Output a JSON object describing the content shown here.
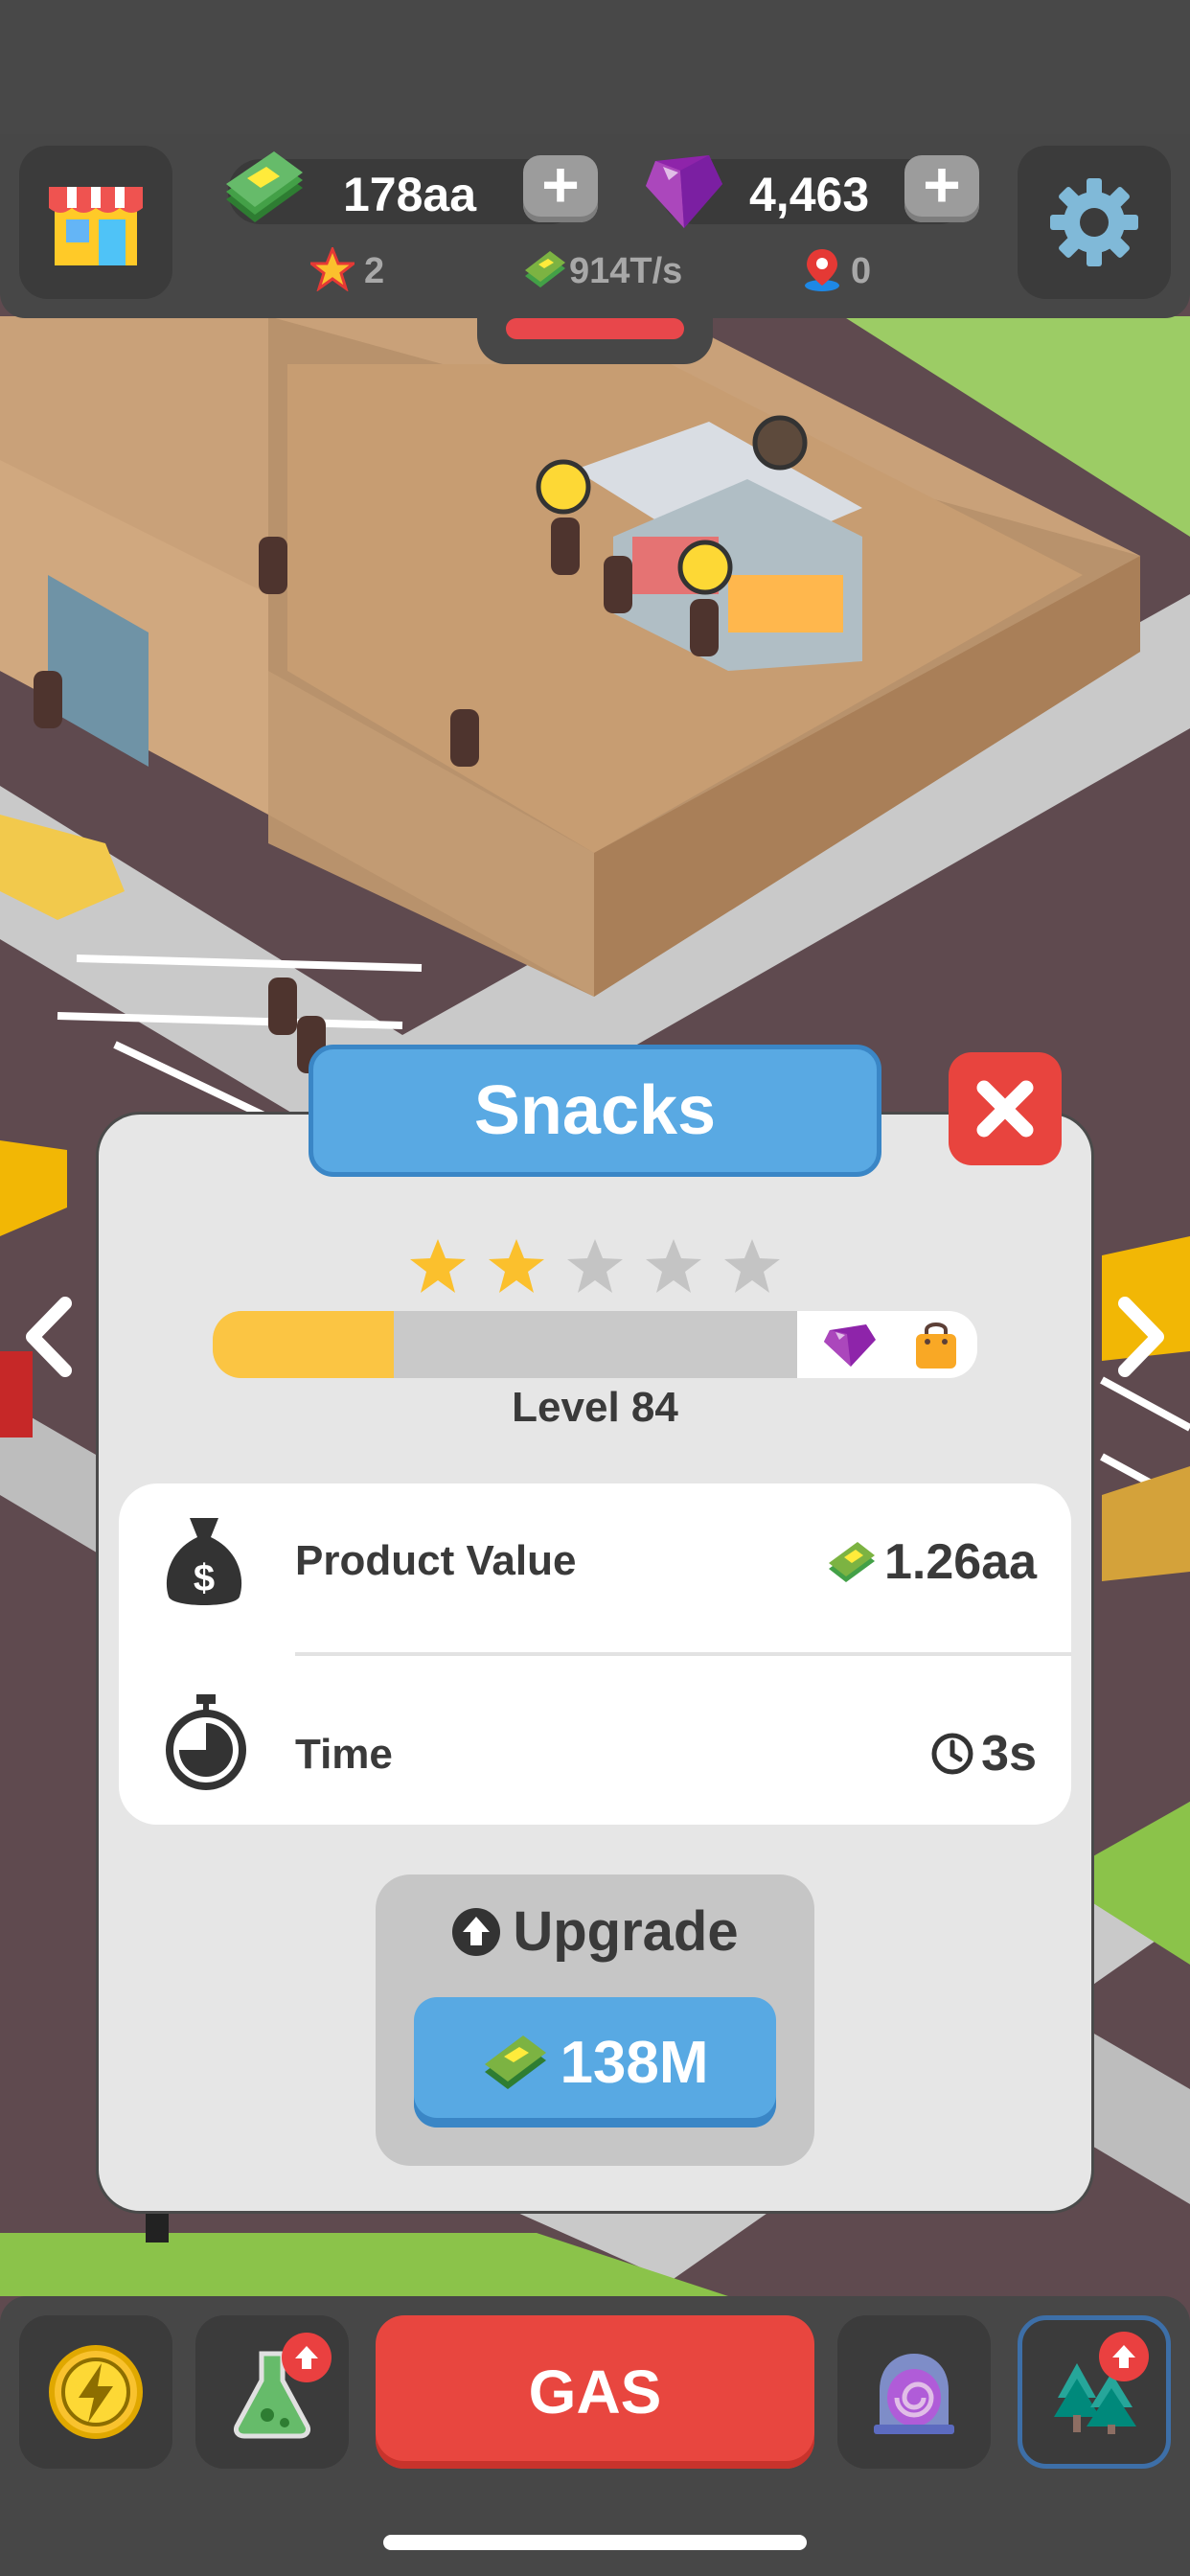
{
  "hud": {
    "cash": "178aa",
    "gems": "4,463",
    "stars": "2",
    "income": "914T/s",
    "locations": "0"
  },
  "dialog": {
    "title": "Snacks",
    "stars_filled": 2,
    "stars_total": 5,
    "level_progress": 0.31,
    "level": "Level 84",
    "stats": [
      {
        "label": "Product Value",
        "value": "1.26aa",
        "icon": "money-bag-icon",
        "value_icon": "cash-icon"
      },
      {
        "label": "Time",
        "value": "3s",
        "icon": "stopwatch-icon",
        "value_icon": "clock-icon"
      }
    ],
    "upgrade_label": "Upgrade",
    "upgrade_cost": "138M"
  },
  "bottom_nav": {
    "gas_label": "GAS"
  },
  "colors": {
    "accent_blue": "#59a9e3",
    "close_red": "#e8443e",
    "gas_red": "#e8463f",
    "progress_yellow": "#fbc543",
    "star_gold": "#fbc02d"
  }
}
